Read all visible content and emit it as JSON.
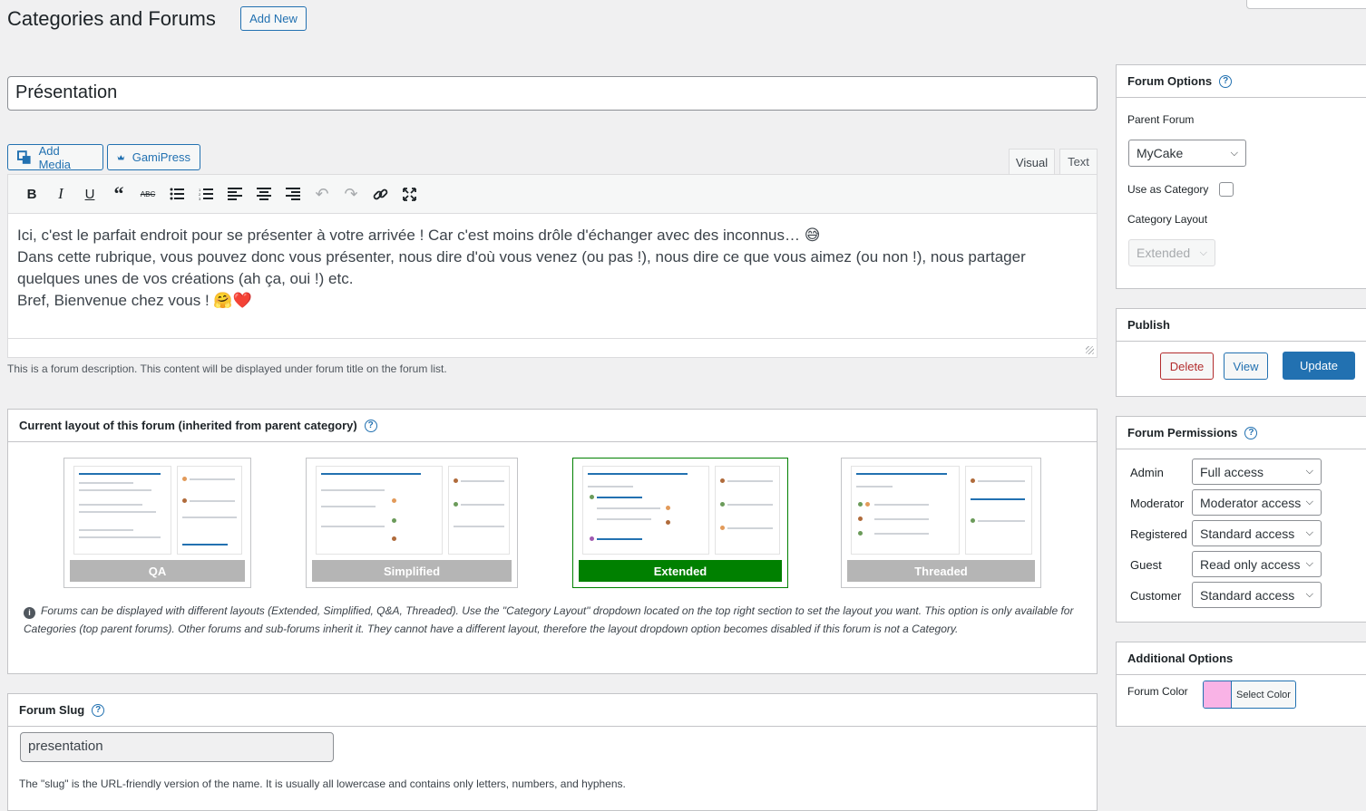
{
  "header": {
    "title": "Categories and Forums",
    "add_new": "Add New"
  },
  "forum_title": "Présentation",
  "editor": {
    "add_media": "Add Media",
    "gamipress": "GamiPress",
    "tabs": [
      "Visual",
      "Text"
    ],
    "active_tab": "Visual",
    "toolbar_icons": [
      "bold-icon",
      "italic-icon",
      "underline-icon",
      "blockquote-icon",
      "strikethrough-icon",
      "bullet-list-icon",
      "numbered-list-icon",
      "align-left-icon",
      "align-center-icon",
      "align-right-icon",
      "undo-icon",
      "redo-icon",
      "link-icon",
      "fullscreen-icon"
    ],
    "content": [
      "Ici, c'est le parfait endroit pour se présenter à votre arrivée ! Car c'est moins drôle d'échanger avec des inconnus… 😅",
      "Dans cette rubrique, vous pouvez donc vous présenter, nous dire d'où vous venez (ou pas !), nous dire ce que vous aimez (ou non !), nous partager quelques unes de vos créations (ah ça, oui !) etc.",
      "Bref, Bienvenue chez vous ! 🤗❤️"
    ],
    "description": "This is a forum description. This content will be displayed under forum title on the forum list."
  },
  "layout": {
    "heading": "Current layout of this forum (inherited from parent category)",
    "options": [
      "QA",
      "Simplified",
      "Extended",
      "Threaded"
    ],
    "selected": "Extended",
    "selected_color": "#008000",
    "info": "Forums can be displayed with different layouts (Extended, Simplified, Q&A, Threaded). Use the \"Category Layout\" dropdown located on the top right section to set the layout you want. This option is only available for Categories (top parent forums). Other forums and sub-forums inherit it. They cannot have a different layout, therefore the layout dropdown option becomes disabled if this forum is not a Category."
  },
  "slug": {
    "heading": "Forum Slug",
    "value": "presentation",
    "description": "The \"slug\" is the URL-friendly version of the name. It is usually all lowercase and contains only letters, numbers, and hyphens."
  },
  "forum_options": {
    "heading": "Forum Options",
    "parent_label": "Parent Forum",
    "parent_value": "MyCake",
    "use_as_category": "Use as Category",
    "category_layout_label": "Category Layout",
    "category_layout_value": "Extended"
  },
  "publish": {
    "heading": "Publish",
    "delete": "Delete",
    "view": "View",
    "update": "Update"
  },
  "permissions": {
    "heading": "Forum Permissions",
    "rows": [
      {
        "role": "Admin",
        "value": "Full access"
      },
      {
        "role": "Moderator",
        "value": "Moderator access"
      },
      {
        "role": "Registered",
        "value": "Standard access"
      },
      {
        "role": "Guest",
        "value": "Read only access"
      },
      {
        "role": "Customer",
        "value": "Standard access"
      }
    ]
  },
  "additional": {
    "heading": "Additional Options",
    "color_label": "Forum Color",
    "color_button": "Select Color",
    "color_value": "#f9b3e6"
  },
  "colors": {
    "accent": "#2271b1",
    "danger": "#b32d2e",
    "selected": "#008000"
  }
}
